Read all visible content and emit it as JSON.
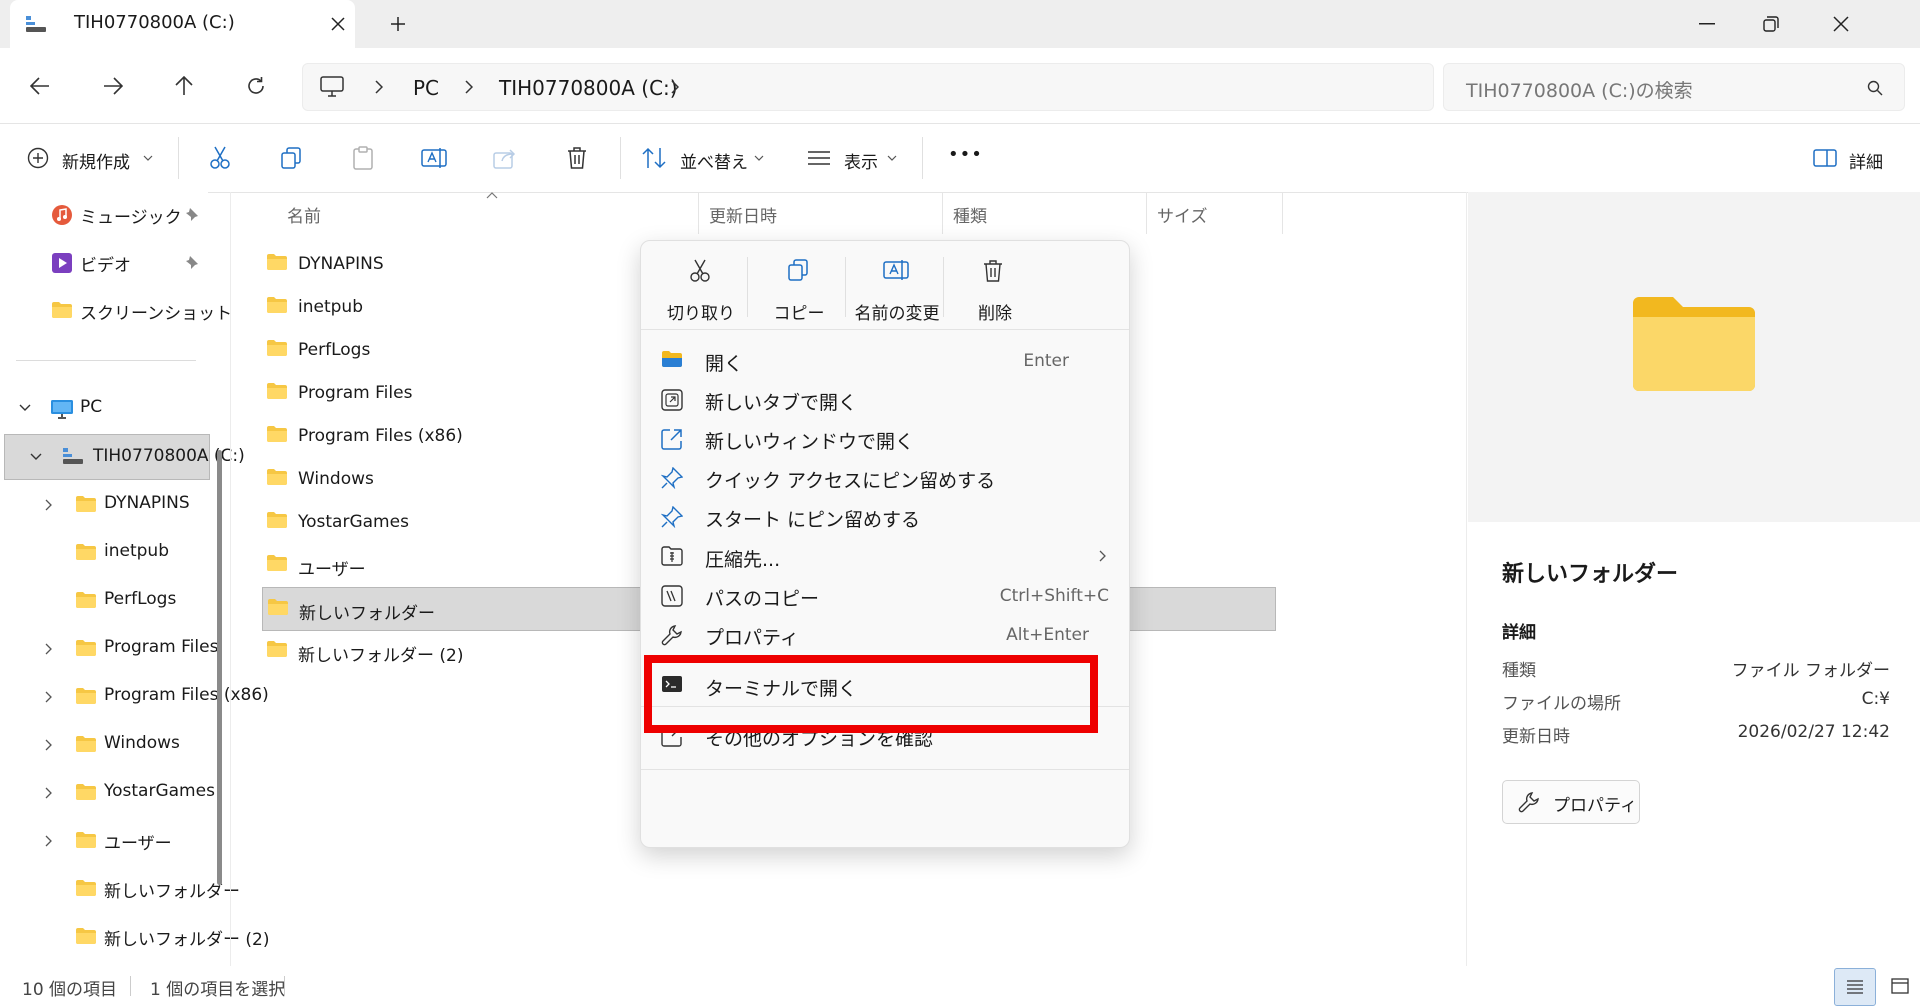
{
  "window": {
    "tab_title": "TIH0770800A (C:)",
    "new_tab_symbol": "+"
  },
  "address": {
    "crumbs": [
      "PC",
      "TIH0770800A (C:)"
    ],
    "search_placeholder": "TIH0770800A (C:)の検索"
  },
  "toolbar": {
    "new_label": "新規作成",
    "sort_label": "並べ替え",
    "view_label": "表示",
    "more_label": "•••",
    "details_label": "詳細"
  },
  "sidebar": {
    "quick": [
      {
        "label": "ミュージック",
        "icon": "music-icon",
        "pinned": true
      },
      {
        "label": "ビデオ",
        "icon": "video-icon",
        "pinned": true
      },
      {
        "label": "スクリーンショット",
        "icon": "folder-icon",
        "pinned": false
      }
    ],
    "pc_label": "PC",
    "drive_label": "TIH0770800A (C:)",
    "children": [
      {
        "label": "DYNAPINS",
        "expandable": true
      },
      {
        "label": "inetpub",
        "expandable": false
      },
      {
        "label": "PerfLogs",
        "expandable": false
      },
      {
        "label": "Program Files",
        "expandable": true
      },
      {
        "label": "Program Files (x86)",
        "expandable": true
      },
      {
        "label": "Windows",
        "expandable": true
      },
      {
        "label": "YostarGames",
        "expandable": true
      },
      {
        "label": "ユーザー",
        "expandable": true
      },
      {
        "label": "新しいフォルダー",
        "expandable": false
      },
      {
        "label": "新しいフォルダー (2)",
        "expandable": false
      }
    ]
  },
  "columns": {
    "name": "名前",
    "modified": "更新日時",
    "type": "種類",
    "size": "サイズ"
  },
  "files": [
    {
      "name": "DYNAPINS",
      "selected": false
    },
    {
      "name": "inetpub",
      "selected": false
    },
    {
      "name": "PerfLogs",
      "selected": false
    },
    {
      "name": "Program Files",
      "selected": false
    },
    {
      "name": "Program Files (x86)",
      "selected": false
    },
    {
      "name": "Windows",
      "selected": false
    },
    {
      "name": "YostarGames",
      "selected": false
    },
    {
      "name": "ユーザー",
      "selected": false
    },
    {
      "name": "新しいフォルダー",
      "selected": true
    },
    {
      "name": "新しいフォルダー (2)",
      "selected": false
    }
  ],
  "context_menu": {
    "quick_actions": [
      {
        "label": "切り取り",
        "icon": "cut-icon"
      },
      {
        "label": "コピー",
        "icon": "copy-icon"
      },
      {
        "label": "名前の変更",
        "icon": "rename-icon"
      },
      {
        "label": "削除",
        "icon": "delete-icon"
      }
    ],
    "items": [
      {
        "label": "開く",
        "shortcut": "Enter",
        "icon": "folder-open-icon"
      },
      {
        "label": "新しいタブで開く",
        "shortcut": "",
        "icon": "new-tab-icon"
      },
      {
        "label": "新しいウィンドウで開く",
        "shortcut": "",
        "icon": "new-window-icon"
      },
      {
        "label": "クイック アクセスにピン留めする",
        "shortcut": "",
        "icon": "pin-icon"
      },
      {
        "label": "スタート にピン留めする",
        "shortcut": "",
        "icon": "pin-icon"
      },
      {
        "label": "圧縮先...",
        "shortcut": "",
        "icon": "zip-icon"
      },
      {
        "label": "パスのコピー",
        "shortcut": "Ctrl+Shift+C",
        "icon": "copy-path-icon"
      },
      {
        "label": "プロパティ",
        "shortcut": "Alt+Enter",
        "icon": "wrench-icon"
      },
      {
        "label": "ターミナルで開く",
        "shortcut": "",
        "icon": "terminal-icon"
      },
      {
        "label": "その他のオプションを確認",
        "shortcut": "",
        "icon": "more-options-icon"
      }
    ],
    "highlight_color": "#ee0000"
  },
  "details": {
    "title": "新しいフォルダー",
    "section": "詳細",
    "rows": [
      {
        "label": "種類",
        "value": "ファイル フォルダー"
      },
      {
        "label": "ファイルの場所",
        "value": "C:¥"
      },
      {
        "label": "更新日時",
        "value": "2026/02/27 12:42"
      }
    ],
    "properties_button": "プロパティ"
  },
  "status": {
    "count": "10 個の項目",
    "selected": "1 個の項目を選択"
  },
  "colors": {
    "folder": "#f6c744",
    "folder_dark": "#e8a813",
    "selection": "#d9d9d9",
    "accent": "#0067c0"
  }
}
